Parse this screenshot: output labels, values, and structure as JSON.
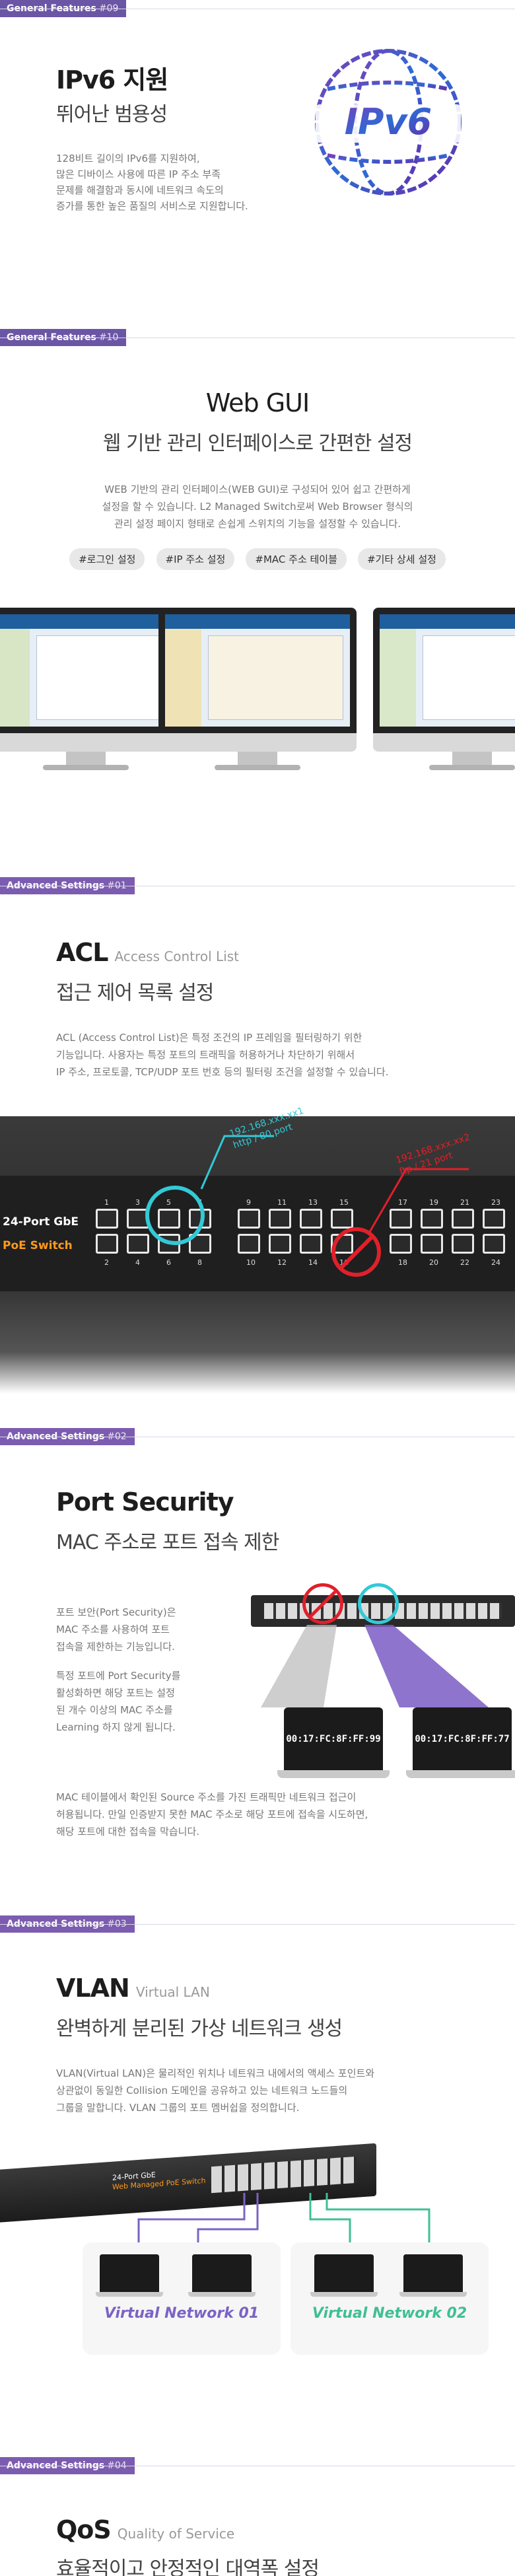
{
  "sec_ipv6": {
    "tag": "General Features",
    "tag_num": "#09",
    "title": "IPv6 지원",
    "subtitle": "뛰어난 범용성",
    "lines": [
      "128비트 길이의 IPv6를 지원하여,",
      "많은 디바이스 사용에 따른 IP 주소 부족",
      "문제를 해결함과 동시에 네트워크 속도의",
      "증가를 통한 높은 품질의 서비스로 지원합니다."
    ],
    "logo_text": "IPv6"
  },
  "sec_webgui": {
    "tag": "General Features",
    "tag_num": "#10",
    "title": "Web GUI",
    "subtitle": "웹 기반 관리 인터페이스로 간편한 설정",
    "lines": [
      "WEB 기반의 관리 인터페이스(WEB GUI)로 구성되어 있어 쉽고 간편하게",
      "설정을 할 수 있습니다. L2 Managed Switch로써 Web Browser 형식의",
      "관리 설정 페이지 형태로 손쉽게 스위치의 기능을 설정할 수 있습니다."
    ],
    "pills": [
      "#로그인 설정",
      "#IP 주소 설정",
      "#MAC 주소 테이블",
      "#기타 상세 설정"
    ]
  },
  "sec_acl": {
    "tag": "Advanced Settings",
    "tag_num": "#01",
    "title": "ACL",
    "title_small": "Access Control List",
    "subtitle": "접근 제어 목록 설정",
    "lines": [
      "ACL (Access Control List)은 특정 조건의 IP 프레임을 필터링하기 위한",
      "기능입니다. 사용자는 특정 포트의 트래픽을 허용하거나 차단하기 위해서",
      "IP 주소, 프로토콜, TCP/UDP 포트 번호 등의 필터링 조건을 설정할 수 있습니다."
    ],
    "allow_label": [
      "192.168.xxx.xx1",
      "http / 80 port"
    ],
    "deny_label": [
      "192.168.xxx.xx2",
      "ftp / 21 port"
    ],
    "switch_text": [
      "24-Port GbE",
      "PoE Switch"
    ],
    "port_top": [
      "1",
      "3",
      "5",
      "7",
      "9",
      "11",
      "13",
      "15",
      "17",
      "19",
      "21",
      "23"
    ],
    "port_bottom": [
      "2",
      "4",
      "6",
      "8",
      "10",
      "12",
      "14",
      "16",
      "18",
      "20",
      "22",
      "24"
    ]
  },
  "sec_portsec": {
    "tag": "Advanced Settings",
    "tag_num": "#02",
    "title": "Port Security",
    "subtitle": "MAC 주소로 포트 접속 제한",
    "left_lines_1": [
      "포트 보안(Port Security)은",
      "MAC 주소를 사용하여 포트",
      "접속을 제한하는 기능입니다."
    ],
    "left_lines_2": [
      "특정 포트에 Port Security를",
      "활성화하면 해당 포트는 설정",
      "된 개수 이상의 MAC 주소를",
      "Learning 하지 않게 됩니다."
    ],
    "bottom_lines": [
      "MAC 테이블에서 확인된 Source 주소를 가진 트래픽만 네트워크 접근이",
      "허용됩니다. 만일 인증받지 못한 MAC 주소로 해당 포트에 접속을 시도하면,",
      "해당 포트에 대한 접속을 막습니다."
    ],
    "mac_1": "00:17:FC:8F:FF:99",
    "mac_2": "00:17:FC:8F:FF:77"
  },
  "sec_vlan": {
    "tag": "Advanced Settings",
    "tag_num": "#03",
    "title": "VLAN",
    "title_small": "Virtual LAN",
    "subtitle": "완벽하게 분리된 가상 네트워크 생성",
    "lines": [
      "VLAN(Virtual LAN)은 물리적인 위치나 네트워크 내에서의 액세스 포인트와",
      "상관없이 동일한 Collision 도메인을 공유하고 있는 네트워크 노드들의",
      "그룹을 말합니다. VLAN 그룹의 포트 멤버쉽을 정의합니다."
    ],
    "switch_text": [
      "24-Port GbE",
      "Web Managed PoE Switch"
    ],
    "vn1": "Virtual Network 01",
    "vn2": "Virtual Network 02"
  },
  "sec_qos": {
    "tag": "Advanced Settings",
    "tag_num": "#04",
    "title": "QoS",
    "title_small": "Quality of Service",
    "subtitle": "효율적이고 안정적인 대역폭 설정"
  },
  "colors": {
    "purple": "#6b55a5",
    "cyan": "#33c9d6",
    "red": "#e0202a",
    "vn1": "#7b63c4",
    "vn2": "#3fbf95"
  }
}
